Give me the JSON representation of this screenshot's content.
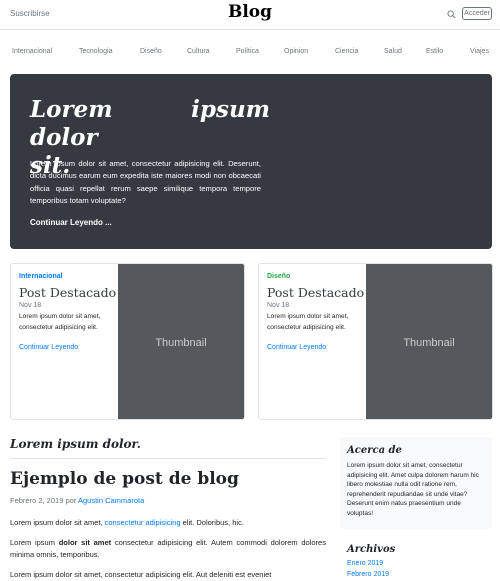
{
  "header": {
    "subscribe_label": "Suscribirse",
    "brand": "Blog",
    "login_label": "Acceder"
  },
  "nav": {
    "items": [
      "Internacional",
      "Tecnologia",
      "Diseño",
      "Cultura",
      "Política",
      "Opinion",
      "Ciencia",
      "Salud",
      "Estilo",
      "Viajes"
    ]
  },
  "jumbotron": {
    "title_line1": "Lorem ipsum dolor",
    "title_line2": "sit.",
    "text": "Lorem ipsum dolor sit amet, consectetur adipisicing elit. Deserunt, dicta ducimus earum eum expedita iste maiores modi non obcaecati officia quasi repellat rerum saepe similique tempora tempore temporibus totam voluptate?",
    "link": "Continuar Leyendo ...",
    "background": "#343a40"
  },
  "cards": [
    {
      "category": "Internacional",
      "category_color": "#007bff",
      "title": "Post Destacado",
      "date": "Nov 18",
      "text": "Lorem ipsum dolor sit amet, consectetur adipisicing elit.",
      "link": "Continuar Leyendo",
      "thumbnail": "Thumbnail"
    },
    {
      "category": "Diseño",
      "category_color": "#28a745",
      "title": "Post Destacado",
      "date": "Nov 18",
      "text": "Lorem ipsum dolor sit amet, consectetur adipisicing elit.",
      "link": "Continuar Leyendo",
      "thumbnail": "Thumbnail"
    }
  ],
  "main": {
    "section_title": "Lorem ipsum dolor.",
    "post": {
      "title": "Ejemplo de post de blog",
      "date": "Febrero 2, 2019",
      "by": "por",
      "author": "Agustin Cammarota",
      "p1_a": "Lorem ipsum dolor sit amet,",
      "p1_link": "consectetur adipisicing",
      "p1_b": "elit. Doloribus, hic.",
      "p2_a": "Lorem ipsum",
      "p2_bold": "dolor sit amet",
      "p2_b": "consectetur adipisicing elit. Autem commodi dolorem dolores minima omnis, temporibus.",
      "p3": "Lorem ipsum dolor sit amet, consectetur adipisicing elit. Aut deleniti est eveniet"
    }
  },
  "sidebar": {
    "about_title": "Acerca de",
    "about_text": "Lorem ipsum dolor sit amet, consectetur adipisicing elit. Amet culpa dolorem harum hic libero molestiae nulla odit ratione rem, reprehenderit repudiandae sit unde vitae? Deserunt enim natus praesentium unde voluptas!",
    "archives_title": "Archivos",
    "archives": [
      "Enero 2019",
      "Febrero 2019"
    ]
  },
  "colors": {
    "link": "#007bff",
    "muted": "#6c757d",
    "thumbnail_bg": "#55595c"
  }
}
